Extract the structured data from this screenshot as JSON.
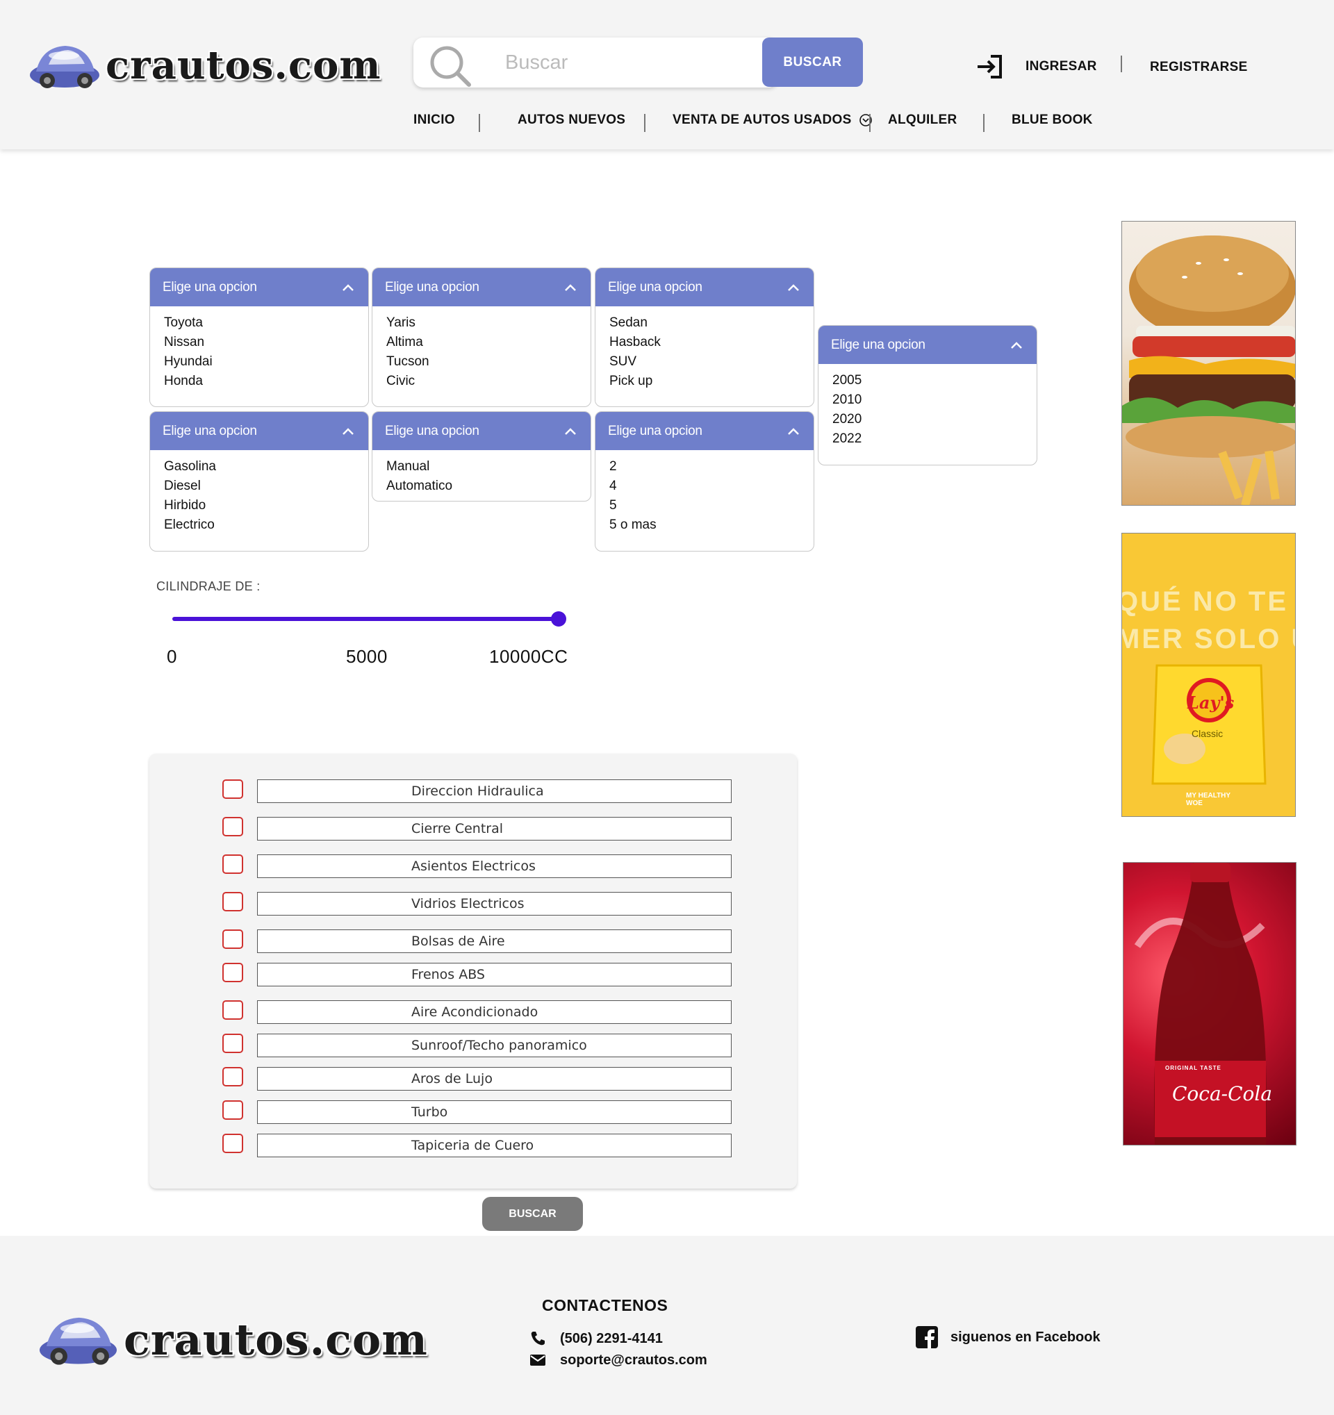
{
  "site": {
    "logo_text": "crautos.com"
  },
  "header": {
    "search_placeholder": "Buscar",
    "search_button": "BUSCAR",
    "login": "INGRESAR",
    "register": "REGISTRARSE"
  },
  "nav": {
    "items": [
      "INICIO",
      "AUTOS NUEVOS",
      "VENTA DE AUTOS USADOS",
      "ALQUILER",
      "BLUE BOOK"
    ]
  },
  "filters": [
    {
      "header": "Elige una opcion",
      "options": [
        "Toyota",
        "Nissan",
        "Hyundai",
        "Honda"
      ]
    },
    {
      "header": "Elige una opcion",
      "options": [
        "Yaris",
        "Altima",
        "Tucson",
        "Civic"
      ]
    },
    {
      "header": "Elige una opcion",
      "options": [
        "Sedan",
        "Hasback",
        "SUV",
        "Pick up"
      ]
    },
    {
      "header": "Elige una opcion",
      "options": [
        "2005",
        "2010",
        "2020",
        "2022"
      ]
    },
    {
      "header": "Elige una opcion",
      "options": [
        "Gasolina",
        "Diesel",
        "Hirbido",
        "Electrico"
      ]
    },
    {
      "header": "Elige una opcion",
      "options": [
        "Manual",
        "Automatico"
      ]
    },
    {
      "header": "Elige una opcion",
      "options": [
        "2",
        "4",
        "5",
        "5 o mas"
      ]
    }
  ],
  "cilindraje": {
    "label": "CILINDRAJE DE :",
    "ticks": [
      "0",
      "5000",
      "10000CC"
    ],
    "value": 10000
  },
  "features": [
    "Direccion Hidraulica",
    "Cierre Central",
    "Asientos Electricos",
    "Vidrios Electricos",
    "Bolsas de Aire",
    "Frenos ABS",
    "Aire Acondicionado",
    "Sunroof/Techo panoramico",
    "Aros de Lujo",
    "Turbo",
    "Tapiceria de Cuero"
  ],
  "search_submit": "BUSCAR",
  "ads": {
    "chips_text_line1": "QUÉ NO TE P",
    "chips_text_line2": "MER SOLO UI",
    "chips_brand": "Lay's",
    "chips_variant": "Classic",
    "chips_tag": "MY HEALTHY WOE",
    "cola_tagline": "ORIGINAL TASTE",
    "cola_brand": "Coca-Cola"
  },
  "footer": {
    "contact_title": "CONTACTENOS",
    "phone": "(506) 2291-4141",
    "email": "soporte@crautos.com",
    "facebook": "siguenos en Facebook"
  },
  "colors": {
    "accent": "#6f7fcb",
    "slider": "#4a12d8",
    "checkbox_border": "#d0322f",
    "header_bg": "#f4f4f4"
  }
}
